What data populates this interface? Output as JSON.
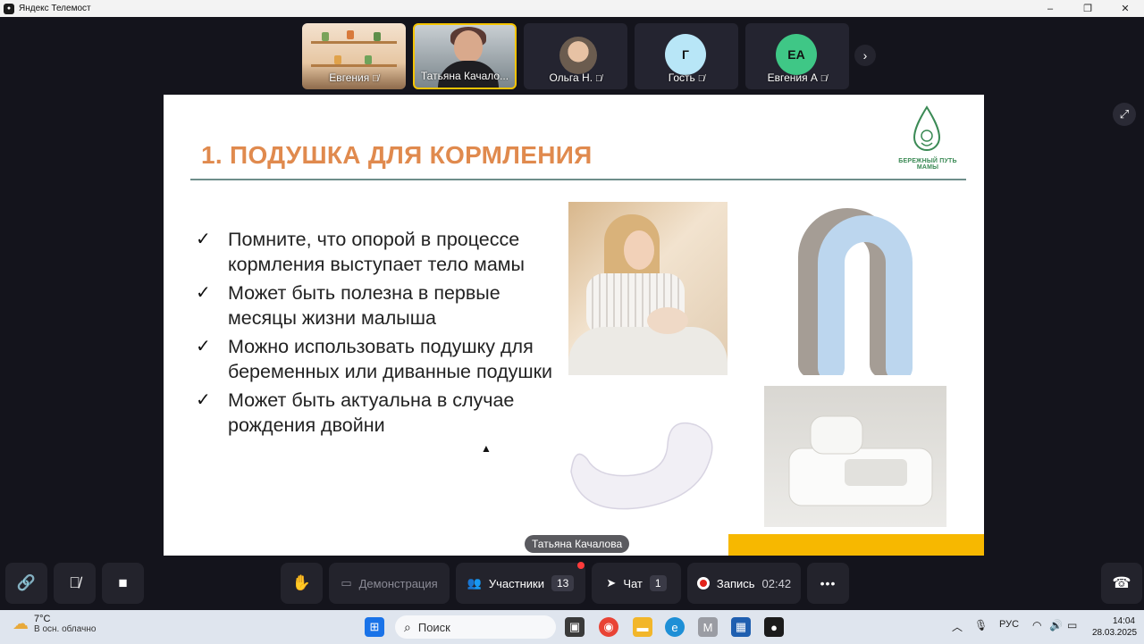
{
  "window": {
    "title": "Яндекс Телемост",
    "minimize": "–",
    "maximize": "❐",
    "close": "✕"
  },
  "participants": [
    {
      "name": "Евгения",
      "mic": "🎙̸"
    },
    {
      "name": "Татьяна Качало...",
      "mic": ""
    },
    {
      "name": "Ольга Н.",
      "mic": "🎙̸"
    },
    {
      "name": "Гость",
      "initials": "Г",
      "color": "#b8e6f7",
      "mic": "🎙̸"
    },
    {
      "name": "Евгения А",
      "initials": "ЕА",
      "color": "#3fc786",
      "mic": "🎙̸"
    }
  ],
  "strip_next": "›",
  "fullscreen": "⤢",
  "slide": {
    "title": "1. ПОДУШКА ДЛЯ КОРМЛЕНИЯ",
    "logo_text": "БЕРЕЖНЫЙ ПУТЬ МАМЫ",
    "check": "✓",
    "bullets": [
      "Помните, что опорой в процессе кормления выступает тело мамы",
      "Может быть полезна в первые месяцы жизни малыша",
      "Можно использовать подушку для беременных или диванные подушки",
      "Может быть актуальна в случае рождения двойни"
    ]
  },
  "speaker_label": "Татьяна Качалова",
  "controls": {
    "link_icon": "🔗",
    "mic_icon": "🎙̸",
    "camera_icon": "■",
    "hand_icon": "✋",
    "demo_label": "Демонстрация",
    "participants_label": "Участники",
    "participants_count": "13",
    "chat_label": "Чат",
    "chat_count": "1",
    "record_label": "Запись",
    "record_time": "02:42",
    "more_icon": "•••",
    "hangup_icon": "☎"
  },
  "taskbar": {
    "temp": "7°C",
    "weather": "В осн. облачно",
    "search_placeholder": "Поиск",
    "lang": "РУС",
    "time": "14:04",
    "date": "28.03.2025"
  },
  "colors": {
    "accent_yellow": "#f5c400",
    "title_orange": "#e08a4e",
    "logo_green": "#3b8a55",
    "bar_yellow": "#f7b800"
  }
}
